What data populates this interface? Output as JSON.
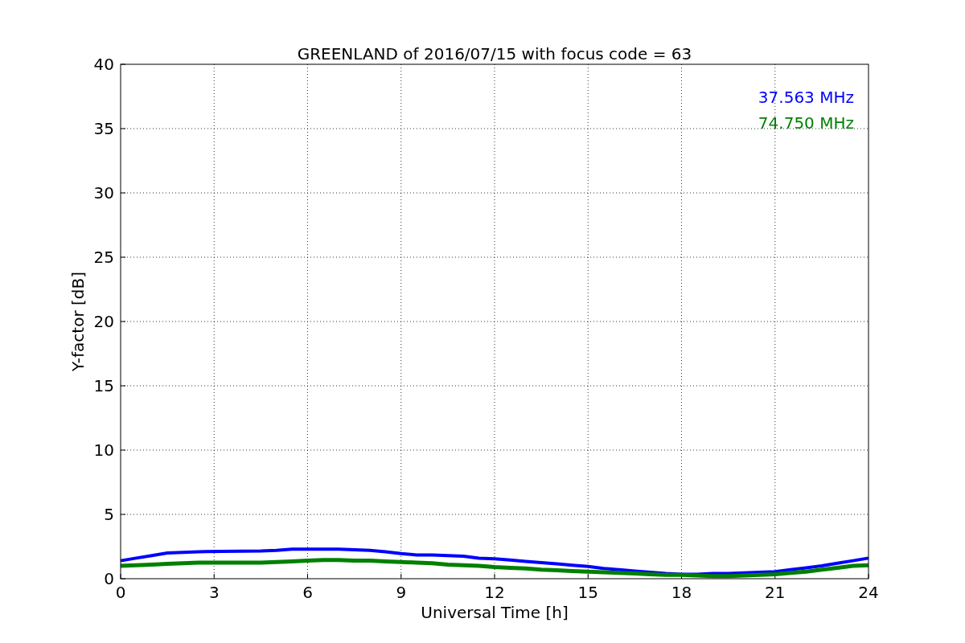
{
  "chart_data": {
    "type": "line",
    "title": "GREENLAND of 2016/07/15 with focus code = 63",
    "xlabel": "Universal Time [h]",
    "ylabel": "Y-factor [dB]",
    "x": [
      0,
      0.5,
      1,
      1.5,
      2,
      2.5,
      4.5,
      5,
      5.5,
      6,
      6.5,
      7,
      7.5,
      8,
      8.5,
      9,
      9.5,
      10,
      10.5,
      11,
      11.5,
      12,
      12.5,
      13,
      13.5,
      14,
      14.5,
      15,
      15.5,
      16,
      16.5,
      17,
      17.5,
      18,
      18.5,
      19,
      19.5,
      20,
      20.5,
      21,
      21.5,
      22,
      22.5,
      23,
      23.5,
      24
    ],
    "series": [
      {
        "name": "37.563 MHz",
        "color": "#0000ff",
        "values": [
          1.4,
          1.6,
          1.8,
          2.0,
          2.05,
          2.1,
          2.15,
          2.2,
          2.3,
          2.3,
          2.3,
          2.3,
          2.25,
          2.2,
          2.1,
          1.95,
          1.85,
          1.85,
          1.8,
          1.75,
          1.6,
          1.55,
          1.45,
          1.35,
          1.25,
          1.15,
          1.05,
          0.95,
          0.8,
          0.7,
          0.6,
          0.5,
          0.4,
          0.35,
          0.35,
          0.4,
          0.4,
          0.45,
          0.5,
          0.55,
          0.7,
          0.85,
          1.0,
          1.2,
          1.4,
          1.6
        ]
      },
      {
        "name": "74.750 MHz",
        "color": "#008000",
        "values": [
          1.0,
          1.05,
          1.1,
          1.15,
          1.2,
          1.25,
          1.25,
          1.3,
          1.35,
          1.4,
          1.45,
          1.45,
          1.4,
          1.4,
          1.35,
          1.3,
          1.25,
          1.2,
          1.1,
          1.05,
          1.0,
          0.9,
          0.85,
          0.8,
          0.7,
          0.65,
          0.6,
          0.55,
          0.5,
          0.45,
          0.4,
          0.35,
          0.3,
          0.3,
          0.25,
          0.2,
          0.2,
          0.25,
          0.3,
          0.35,
          0.45,
          0.55,
          0.7,
          0.85,
          1.0,
          1.05
        ]
      }
    ],
    "xlim": [
      0,
      24
    ],
    "ylim": [
      0,
      40
    ],
    "xticks": [
      0,
      3,
      6,
      9,
      12,
      15,
      18,
      21,
      24
    ],
    "yticks": [
      0,
      5,
      10,
      15,
      20,
      25,
      30,
      35,
      40
    ],
    "grid": true
  }
}
